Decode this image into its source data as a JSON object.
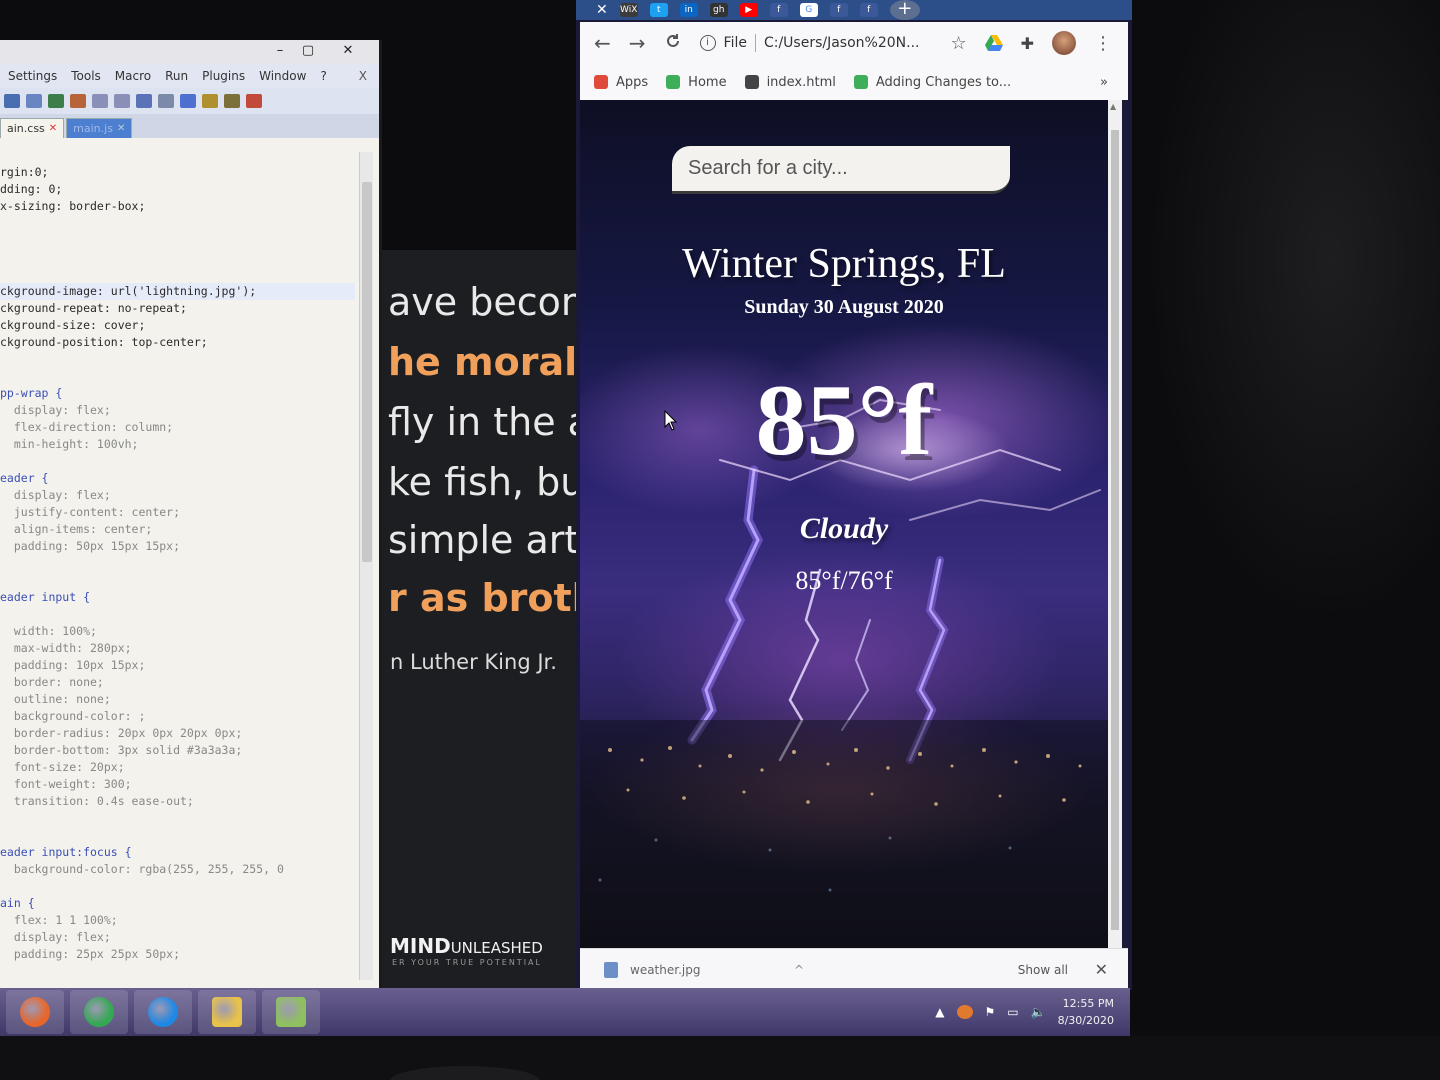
{
  "editor": {
    "window_controls": [
      "–",
      "▢",
      "✕"
    ],
    "menu": [
      "Settings",
      "Tools",
      "Macro",
      "Run",
      "Plugins",
      "Window",
      "?"
    ],
    "menu_close": "X",
    "tabs": [
      {
        "label": "ain.css",
        "active": true
      },
      {
        "label": "main.js",
        "active": false
      }
    ],
    "code_lines": [
      "rgin:0;",
      "dding: 0;",
      "x-sizing: border-box;",
      "",
      "",
      "",
      "",
      "ckground-image: url('lightning.jpg');",
      "ckground-repeat: no-repeat;",
      "ckground-size: cover;",
      "ckground-position: top-center;",
      "",
      "",
      "pp-wrap {",
      "  display: flex;",
      "  flex-direction: column;",
      "  min-height: 100vh;",
      "",
      "eader {",
      "  display: flex;",
      "  justify-content: center;",
      "  align-items: center;",
      "  padding: 50px 15px 15px;",
      "",
      "",
      "eader input {",
      "",
      "  width: 100%;",
      "  max-width: 280px;",
      "  padding: 10px 15px;",
      "  border: none;",
      "  outline: none;",
      "  background-color: ;",
      "  border-radius: 20px 0px 20px 0px;",
      "  border-bottom: 3px solid #3a3a3a;",
      "  font-size: 20px;",
      "  font-weight: 300;",
      "  transition: 0.4s ease-out;",
      "",
      "",
      "eader input:focus {",
      "  background-color: rgba(255, 255, 255, 0",
      "",
      "ain {",
      "  flex: 1 1 100%;",
      "  display: flex;",
      "  padding: 25px 25px 50px;"
    ]
  },
  "quote": {
    "lines": [
      {
        "text": "ave becom",
        "accent": false
      },
      {
        "text": "he morally",
        "accent": true
      },
      {
        "text": "fly in the a",
        "accent": false
      },
      {
        "text": "ke fish, bu",
        "accent": false
      },
      {
        "text": "simple art",
        "accent": false
      },
      {
        "text": "r as broth",
        "accent": true
      }
    ],
    "author": "n Luther King Jr.",
    "brand_bold": "MIND",
    "brand_rest": "UNLEASHED",
    "tagline": "ER YOUR TRUE POTENTIAL"
  },
  "browser": {
    "tab_close": "✕",
    "tab_favicons": [
      {
        "icon": "wix-icon",
        "label": "WiX",
        "color": "#3b3b3b"
      },
      {
        "icon": "twitter-icon",
        "label": "t",
        "color": "#1da1f2"
      },
      {
        "icon": "linkedin-icon",
        "label": "in",
        "color": "#0a66c2"
      },
      {
        "icon": "github-icon",
        "label": "gh",
        "color": "#333333"
      },
      {
        "icon": "youtube-icon",
        "label": "▶",
        "color": "#ff0000"
      },
      {
        "icon": "facebook-icon",
        "label": "f",
        "color": "#3b5998"
      },
      {
        "icon": "google-icon",
        "label": "G",
        "color": "#ffffff"
      },
      {
        "icon": "facebook-icon",
        "label": "f",
        "color": "#3b5998"
      },
      {
        "icon": "facebook-icon",
        "label": "f",
        "color": "#3b5998"
      }
    ],
    "new_tab": "+",
    "back": "←",
    "forward": "→",
    "reload": "C",
    "info": "i",
    "scheme": "File",
    "url": "C:/Users/Jason%20N...",
    "bookmarks": [
      {
        "label": "Apps",
        "icon": "apps-grid-icon",
        "color": "#e04a3a"
      },
      {
        "label": "Home",
        "icon": "home-favicon-icon",
        "color": "#3fae5a"
      },
      {
        "label": "index.html",
        "icon": "globe-icon",
        "color": "#444444"
      },
      {
        "label": "Adding Changes to...",
        "icon": "bookmark-favicon-icon",
        "color": "#3fae5a"
      }
    ],
    "bookmarks_more": "»",
    "download": {
      "file": "weather.jpg",
      "show_all": "Show all",
      "close": "✕"
    }
  },
  "weather": {
    "search_placeholder": "Search for a city...",
    "city": "Winter Springs, FL",
    "date": "Sunday 30 August 2020",
    "temp": "85°f",
    "condition": "Cloudy",
    "hi_low": "85°f/76°f"
  },
  "taskbar": {
    "apps": [
      "firefox-icon",
      "chrome-icon",
      "edge-icon",
      "file-explorer-icon",
      "notepad-plus-plus-icon"
    ],
    "time": "12:55 PM",
    "date": "8/30/2020"
  }
}
